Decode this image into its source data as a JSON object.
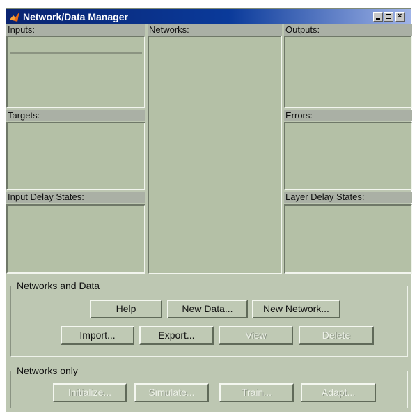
{
  "window": {
    "title": "Network/Data Manager"
  },
  "panels": {
    "inputs_label": "Inputs:",
    "networks_label": "Networks:",
    "outputs_label": "Outputs:",
    "targets_label": "Targets:",
    "errors_label": "Errors:",
    "input_delay_label": "Input Delay States:",
    "layer_delay_label": "Layer Delay States:"
  },
  "networks_and_data": {
    "title": "Networks and Data",
    "help": "Help",
    "new_data": "New Data...",
    "new_network": "New Network...",
    "import": "Import...",
    "export": "Export...",
    "view": "View",
    "delete": "Delete"
  },
  "networks_only": {
    "title": "Networks only",
    "initialize": "Initialize...",
    "simulate": "Simulate...",
    "train": "Train...",
    "adapt": "Adapt..."
  },
  "colors": {
    "window_bg": "#bdc7b2",
    "listbox_bg": "#b4c0a6",
    "titlebar": "#0a2470"
  }
}
